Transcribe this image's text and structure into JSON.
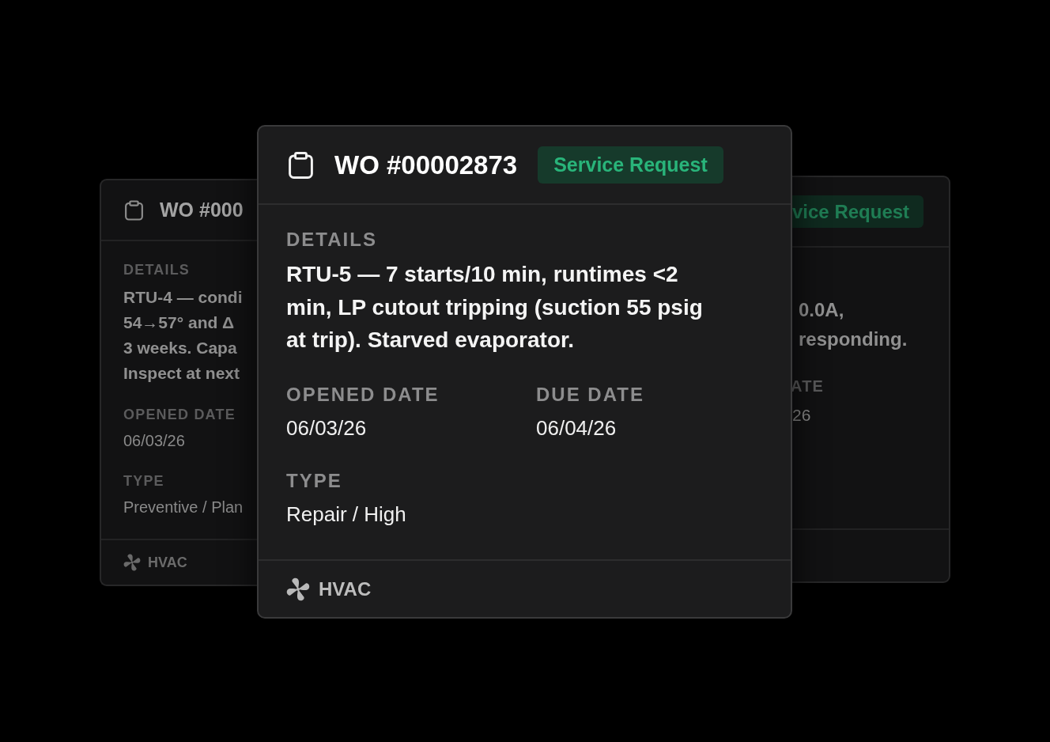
{
  "cards": [
    {
      "kind": "behind",
      "title": "WO #000",
      "details_label": "DETAILS",
      "details_lines": [
        "RTU-4 — condi",
        "54→57° and Δ",
        "3 weeks. Capa",
        "Inspect at next"
      ],
      "fields": [
        {
          "label": "OPENED DATE",
          "value": "06/03/26"
        },
        {
          "label": "TYPE",
          "value": "Preventive / Plan"
        }
      ],
      "category": "HVAC"
    },
    {
      "kind": "behind",
      "badge": "vice Request",
      "details_lines": [
        "0.0A,",
        "responding."
      ],
      "fields": [
        {
          "label": "ATE",
          "value": "26"
        }
      ]
    },
    {
      "kind": "front",
      "title": "WO #00002873",
      "badge": "Service Request",
      "details_label": "DETAILS",
      "details": "RTU-5 — 7 starts/10 min, runtimes <2 min, LP cutout tripping (suction 55 psig at trip). Starved evaporator.",
      "fields": [
        {
          "label": "OPENED DATE",
          "value": "06/03/26"
        },
        {
          "label": "DUE DATE",
          "value": "06/04/26"
        },
        {
          "label": "TYPE",
          "value": "Repair / High"
        }
      ],
      "category": "HVAC"
    }
  ]
}
